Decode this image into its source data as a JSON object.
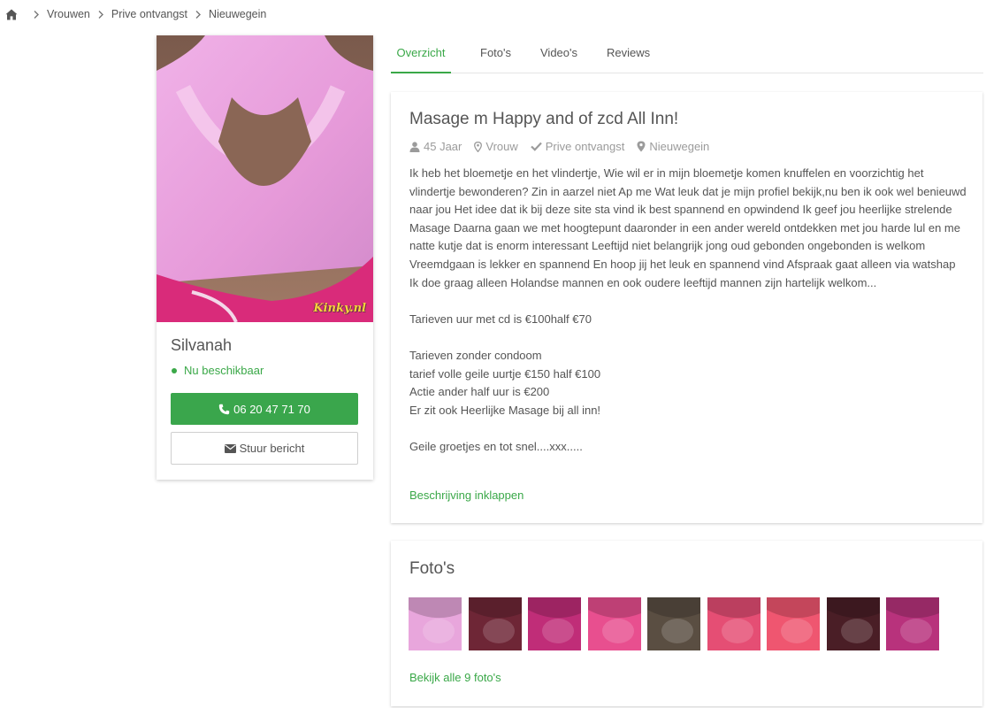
{
  "breadcrumb": {
    "items": [
      "Vrouwen",
      "Prive ontvangst",
      "Nieuwegein"
    ]
  },
  "profile": {
    "watermark": "Kinky.nl",
    "name": "Silvanah",
    "status": "Nu beschikbaar",
    "phone": "06 20 47 71 70",
    "message_label": "Stuur bericht"
  },
  "tabs": [
    "Overzicht",
    "Foto's",
    "Video's",
    "Reviews"
  ],
  "description": {
    "title": "Masage m Happy and of zcd All Inn!",
    "meta": {
      "age": "45 Jaar",
      "gender": "Vrouw",
      "type": "Prive ontvangst",
      "location": "Nieuwegein"
    },
    "paragraphs": [
      "Ik heb het bloemetje en het vlindertje, Wie wil er in mijn bloemetje komen knuffelen en voorzichtig het vlindertje bewonderen? Zin in aarzel niet Ap me Wat leuk dat je mijn profiel bekijk,nu ben ik ook wel benieuwd naar jou Het idee dat ik bij deze site sta vind ik best spannend en opwindend Ik geef jou heerlijke strelende Masage Daarna gaan we met hoogtepunt daaronder in een ander wereld ontdekken met jou harde lul en me natte kutje dat is enorm interessant Leeftijd niet belangrijk jong oud gebonden ongebonden is welkom Vreemdgaan is lekker en spannend En hoop jij het leuk en spannend vind Afspraak gaat alleen via watshap Ik doe graag alleen Holandse mannen en ook oudere leeftijd mannen zijn hartelijk welkom...",
      "Tarieven uur met cd is €100half €70",
      "Tarieven zonder condoom\ntarief volle geile uurtje €150 half €100\nActie ander half uur is €200\nEr zit ook Heerlijke Masage bij all inn!",
      "Geile groetjes en tot snel....xxx....."
    ],
    "collapse_label": "Beschrijving inklappen"
  },
  "photos": {
    "title": "Foto's",
    "thumb_colors": [
      "#e8a6dc",
      "#6e2636",
      "#c02d78",
      "#e84f8f",
      "#5a4e42",
      "#e54e74",
      "#ef5670",
      "#4a1e26",
      "#b8327c"
    ],
    "all_label": "Bekijk alle 9 foto's"
  },
  "colors": {
    "accent": "#3aa848",
    "button_green": "#3aa64c"
  }
}
